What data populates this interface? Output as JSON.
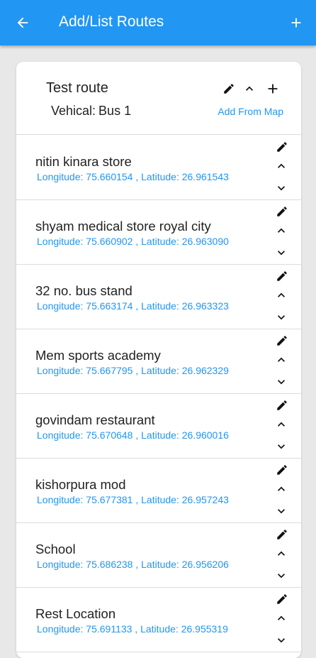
{
  "appbar": {
    "title": "Add/List Routes",
    "back_icon": "arrow-back-icon",
    "add_icon": "plus-icon",
    "color": "#2196f3"
  },
  "route": {
    "name": "Test route",
    "vehicle_label": "Vehical:",
    "vehicle_value": "Bus 1",
    "add_from_map": "Add From Map"
  },
  "stops": [
    {
      "name": "nitin kinara store",
      "coords": "Longitude: 75.660154 , Latitude: 26.961543"
    },
    {
      "name": "shyam medical store royal city",
      "coords": "Longitude: 75.660902 , Latitude: 26.963090"
    },
    {
      "name": "32 no. bus stand",
      "coords": "Longitude: 75.663174 , Latitude: 26.963323"
    },
    {
      "name": "Mem sports academy",
      "coords": "Longitude: 75.667795 , Latitude: 26.962329"
    },
    {
      "name": "govindam restaurant",
      "coords": "Longitude: 75.670648 , Latitude: 26.960016"
    },
    {
      "name": "kishorpura mod",
      "coords": "Longitude: 75.677381 , Latitude: 26.957243"
    },
    {
      "name": "School",
      "coords": "Longitude: 75.686238 , Latitude: 26.956206"
    },
    {
      "name": "Rest Location",
      "coords": "Longitude: 75.691133 , Latitude: 26.955319"
    }
  ]
}
